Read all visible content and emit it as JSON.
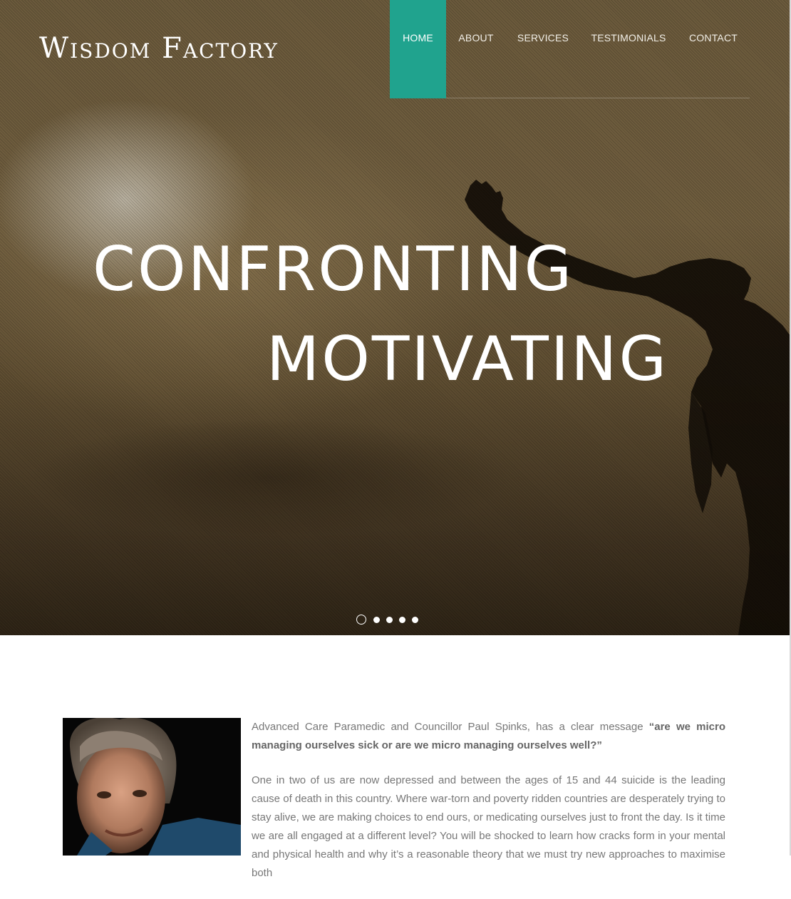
{
  "site": {
    "logo": "Wisdom Factory"
  },
  "nav": {
    "items": [
      {
        "label": "HOME",
        "active": true
      },
      {
        "label": "ABOUT",
        "active": false
      },
      {
        "label": "SERVICES",
        "active": false
      },
      {
        "label": "TESTIMONIALS",
        "active": false
      },
      {
        "label": "CONTACT",
        "active": false
      }
    ],
    "accent_color": "#20a38e"
  },
  "hero": {
    "line1": "CONFRONTING",
    "line2": "MOTIVATING",
    "slider": {
      "count": 5,
      "current": 1
    }
  },
  "intro": {
    "lead": "Advanced Care Paramedic and Councillor Paul Spinks, has a clear message ",
    "quote": "“are we micro managing ourselves sick or are we micro managing ourselves well?”",
    "paragraph2": "One in two of us are now depressed and between the ages of 15 and 44 suicide is the leading cause of death in this country. Where war-torn and poverty ridden countries are desperately trying to stay alive, we are making choices to end ours, or medicating ourselves just to front the day. Is it time we are all engaged at a different level? You will be shocked to learn how cracks form in your mental and physical health and why it’s a reasonable theory that we must try new approaches to maximise both"
  }
}
